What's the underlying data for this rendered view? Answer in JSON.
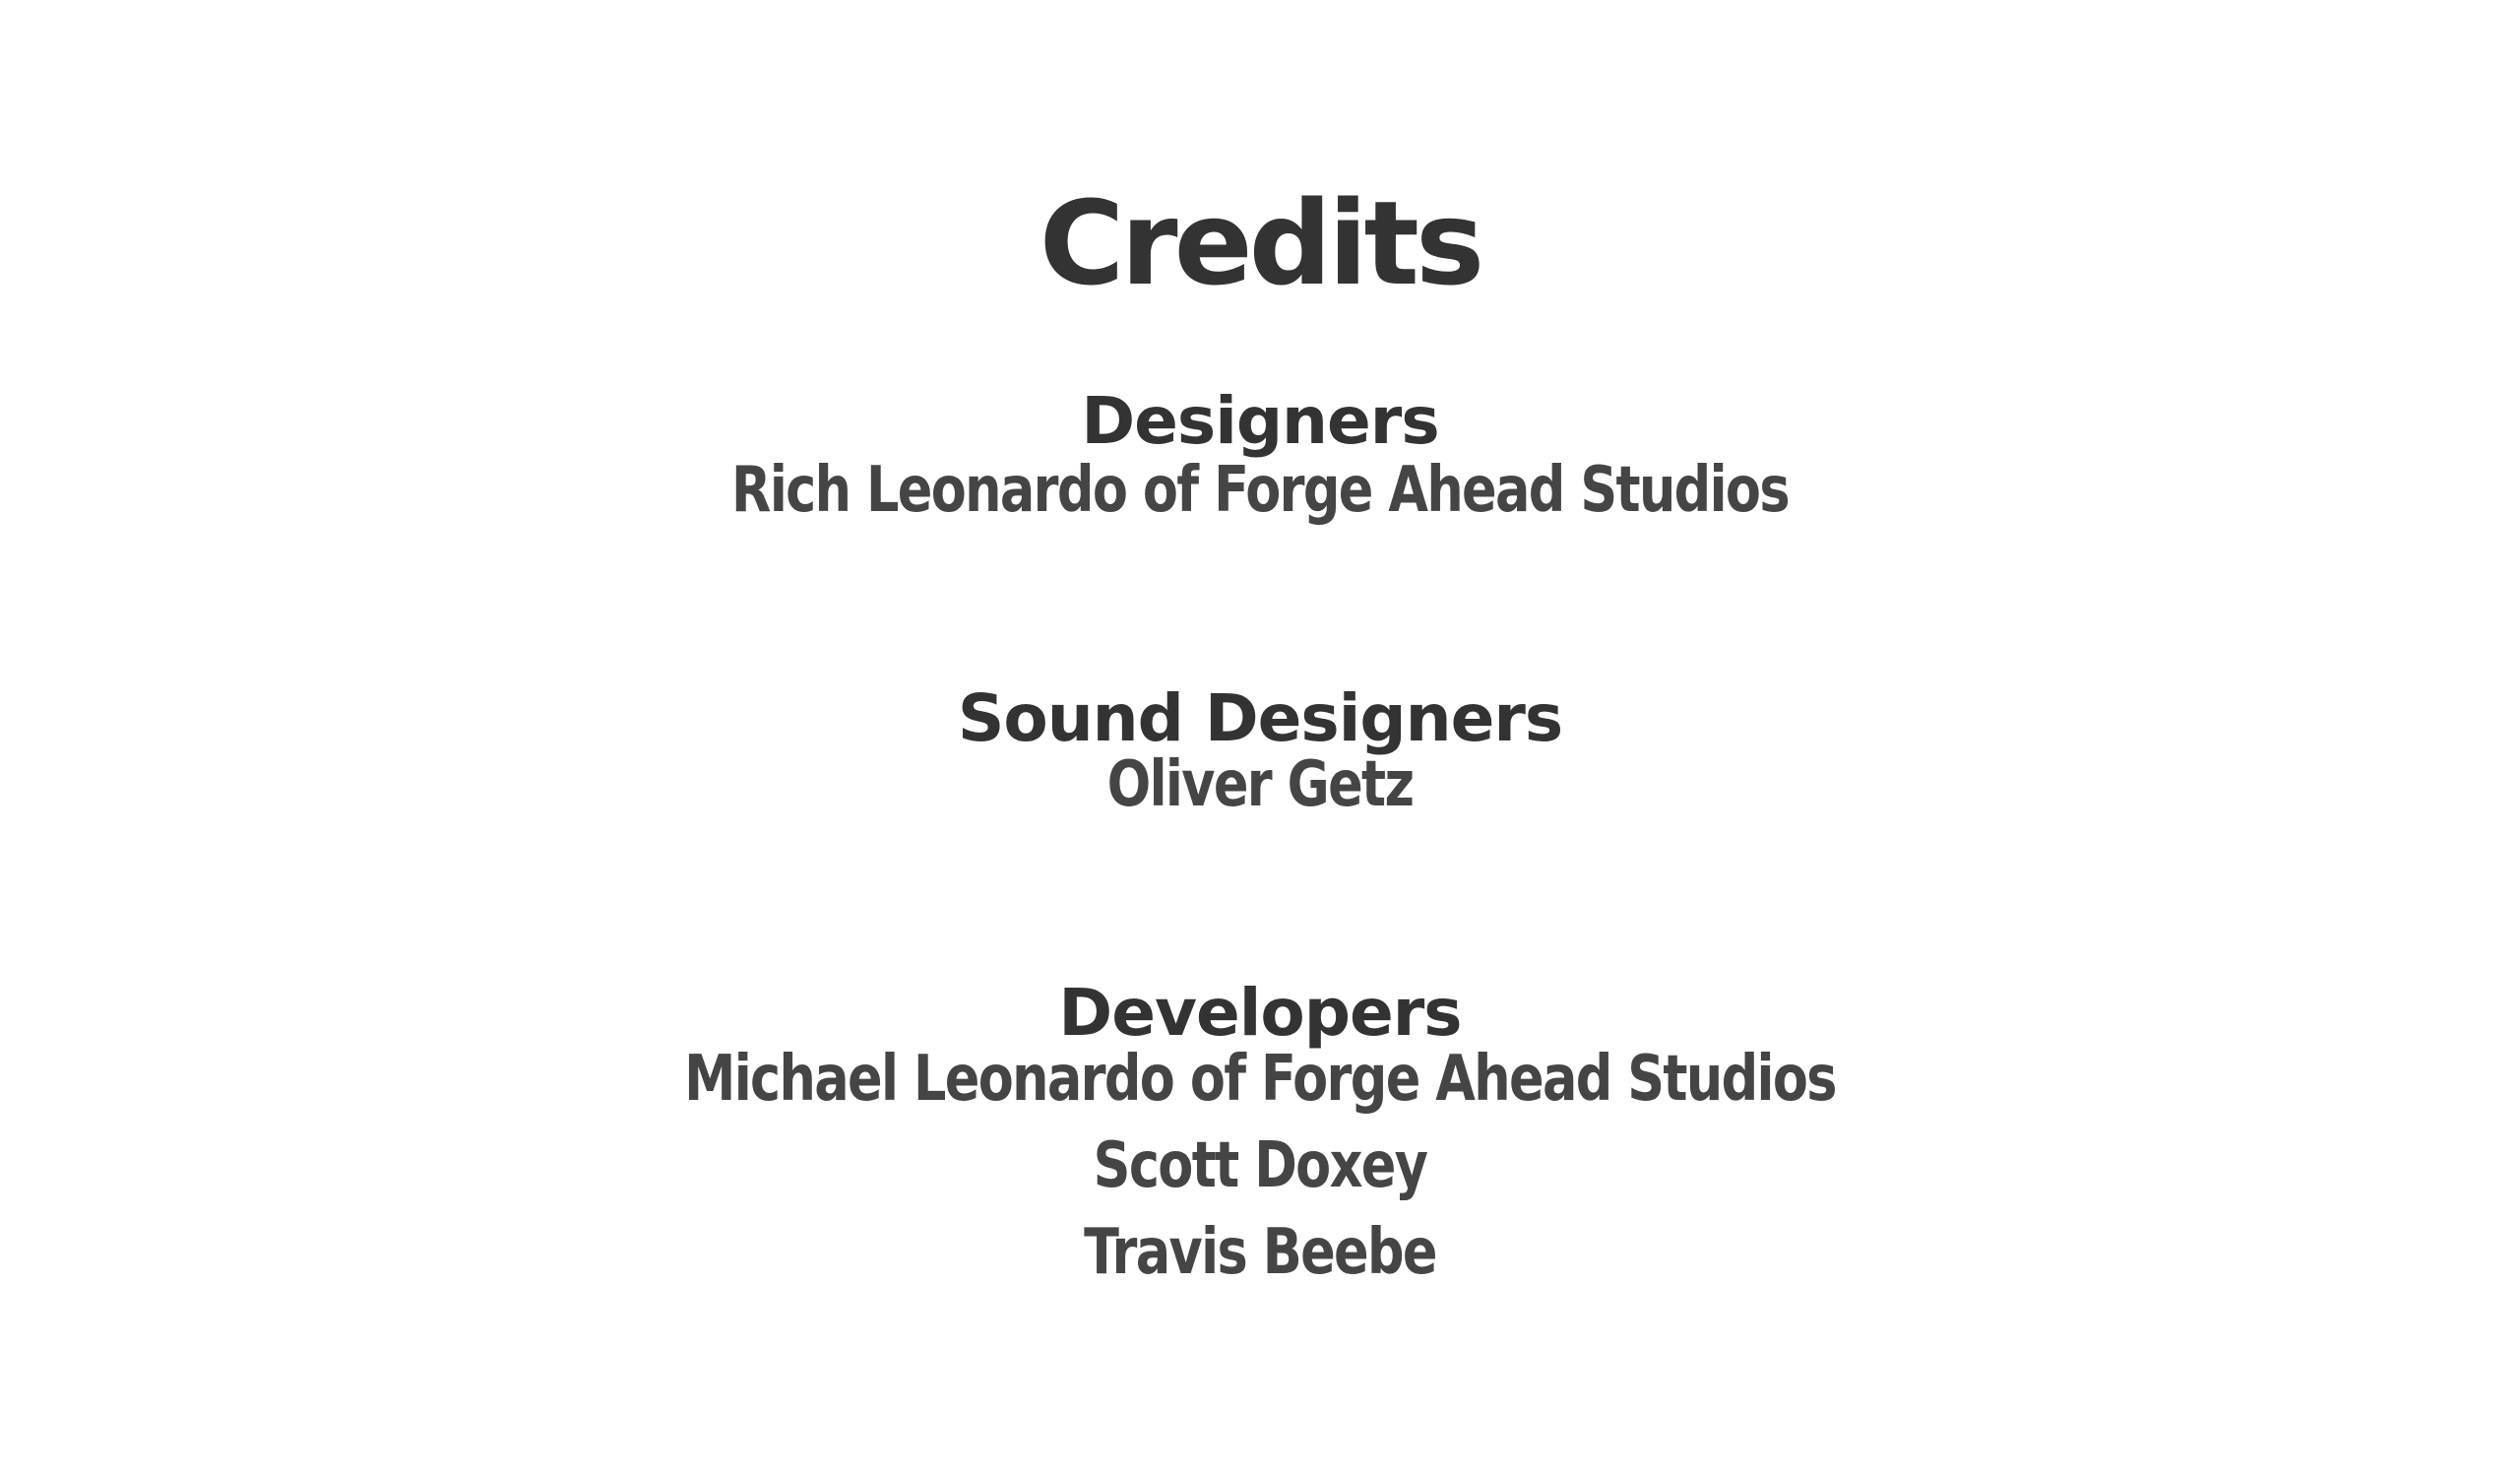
{
  "title": "Credits",
  "sections": [
    {
      "heading": "Designers",
      "names": [
        "Rich Leonardo of Forge Ahead Studios"
      ]
    },
    {
      "heading": "Sound Designers",
      "names": [
        "Oliver Getz"
      ]
    },
    {
      "heading": "Developers",
      "names": [
        "Michael Leonardo of Forge Ahead Studios",
        "Scott Doxey",
        "Travis Beebe"
      ]
    }
  ],
  "colors": {
    "background": "#ffffff",
    "heading_text": "#333333",
    "name_text": "#454545"
  }
}
